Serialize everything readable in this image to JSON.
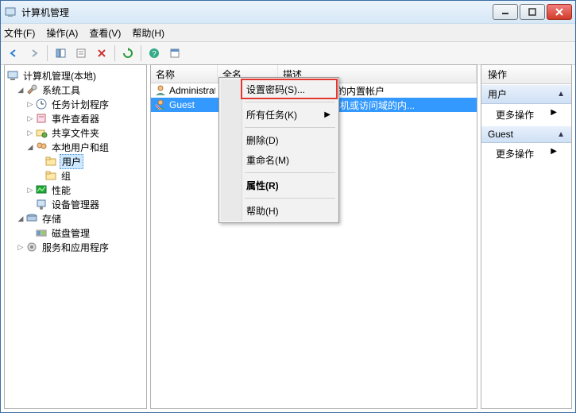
{
  "window": {
    "title": "计算机管理"
  },
  "menubar": {
    "file": "文件(F)",
    "action": "操作(A)",
    "view": "查看(V)",
    "help": "帮助(H)"
  },
  "tree": {
    "root": "计算机管理(本地)",
    "system_tools": "系统工具",
    "task_scheduler": "任务计划程序",
    "event_viewer": "事件查看器",
    "shared_folders": "共享文件夹",
    "local_users_groups": "本地用户和组",
    "users": "用户",
    "groups": "组",
    "performance": "性能",
    "device_manager": "设备管理器",
    "storage": "存储",
    "disk_mgmt": "磁盘管理",
    "services_apps": "服务和应用程序"
  },
  "columns": {
    "name": "名称",
    "fullname": "全名",
    "description": "描述"
  },
  "rows": [
    {
      "name": "Administrat...",
      "fullname": "",
      "desc": "管理计算机(域)的内置帐户"
    },
    {
      "name": "Guest",
      "fullname": "",
      "desc": "供来宾访问计算机或访问域的内..."
    }
  ],
  "context": {
    "set_password": "设置密码(S)...",
    "all_tasks": "所有任务(K)",
    "delete": "删除(D)",
    "rename": "重命名(M)",
    "properties": "属性(R)",
    "help": "帮助(H)"
  },
  "actions": {
    "header": "操作",
    "section_users": "用户",
    "more_actions": "更多操作",
    "section_guest": "Guest"
  }
}
